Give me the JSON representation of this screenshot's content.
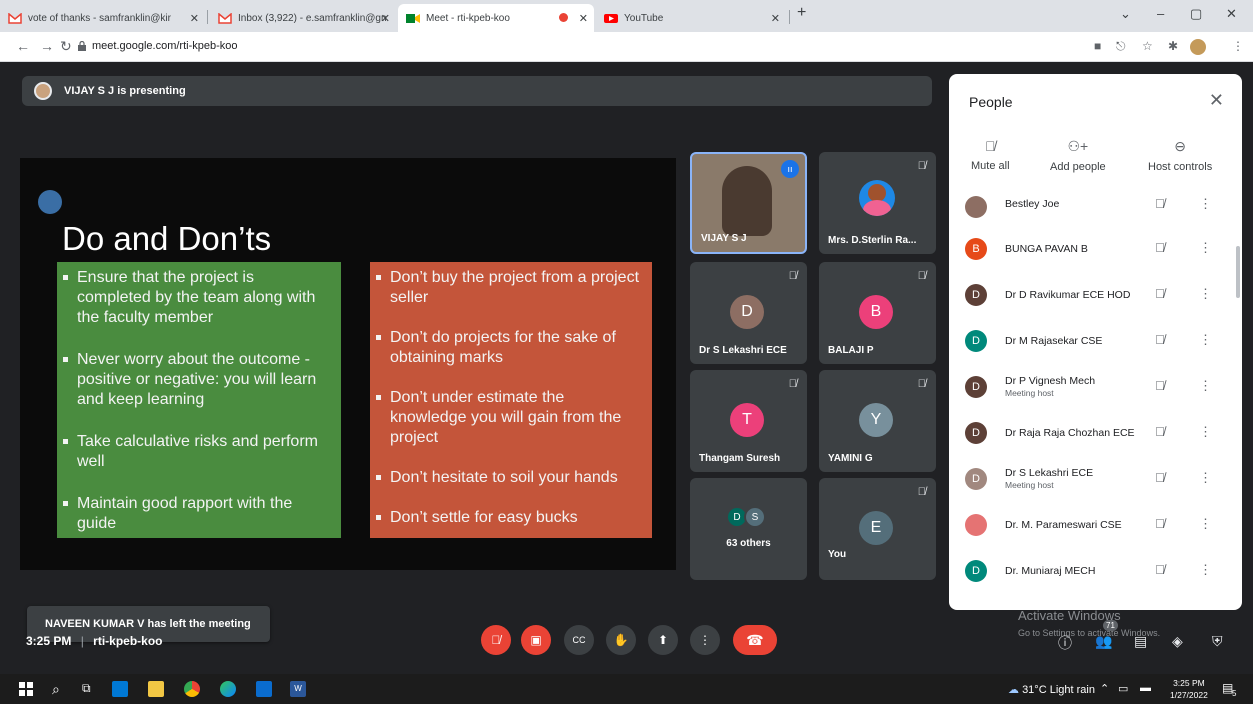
{
  "browser": {
    "tabs": [
      {
        "label": "vote of thanks - samfranklin@kir",
        "icon": "gmail-icon"
      },
      {
        "label": "Inbox (3,922) - e.samfranklin@gn",
        "icon": "gmail-icon"
      },
      {
        "label": "Meet - rti-kpeb-koo",
        "icon": "meet-icon"
      },
      {
        "label": "YouTube",
        "icon": "youtube-icon"
      }
    ],
    "url": "meet.google.com/rti-kpeb-koo"
  },
  "presenting": {
    "text": "VIJAY S J is presenting"
  },
  "slide": {
    "title": "Do and Don’ts",
    "dos": [
      "Ensure that the project is completed by the team along with the faculty member",
      "Never worry about the outcome - positive or negative: you will learn and keep learning",
      "Take calculative risks and perform well",
      "Maintain good rapport with the guide"
    ],
    "donts": [
      "Don’t buy the project from a project seller",
      "Don’t do projects for the sake of obtaining marks",
      "Don’t under estimate the knowledge you will gain from the project",
      "Don’t hesitate to soil your hands",
      "Don’t settle for easy bucks"
    ]
  },
  "toast": "NAVEEN KUMAR V has left the meeting",
  "tiles": {
    "vijay": "VIJAY S J",
    "sterlin": "Mrs. D.Sterlin Ra...",
    "lekashri": {
      "name": "Dr S Lekashri ECE",
      "initial": "D"
    },
    "balaji": {
      "name": "BALAJI P",
      "initial": "B"
    },
    "thangam": {
      "name": "Thangam Suresh",
      "initial": "T"
    },
    "yamini": {
      "name": "YAMINI G",
      "initial": "Y"
    },
    "others": {
      "label": "63 others",
      "initial1": "D",
      "initial2": "S"
    },
    "you": {
      "name": "You",
      "initial": "E"
    }
  },
  "people": {
    "title": "People",
    "controls": {
      "mute_all": "Mute all",
      "add_people": "Add people",
      "host_controls": "Host controls"
    },
    "list": [
      {
        "name": "Bestley Joe",
        "initial": "",
        "color": "#8d6e63",
        "sub": ""
      },
      {
        "name": "BUNGA PAVAN B",
        "initial": "B",
        "color": "#e64a19",
        "sub": ""
      },
      {
        "name": "Dr D Ravikumar ECE HOD",
        "initial": "D",
        "color": "#5d4037",
        "sub": ""
      },
      {
        "name": "Dr M Rajasekar CSE",
        "initial": "D",
        "color": "#00897b",
        "sub": ""
      },
      {
        "name": "Dr P Vignesh Mech",
        "initial": "D",
        "color": "#5d4037",
        "sub": "Meeting host"
      },
      {
        "name": "Dr Raja Raja Chozhan ECE",
        "initial": "D",
        "color": "#5d4037",
        "sub": ""
      },
      {
        "name": "Dr S Lekashri ECE",
        "initial": "D",
        "color": "#a1887f",
        "sub": "Meeting host"
      },
      {
        "name": "Dr. M. Parameswari CSE",
        "initial": "",
        "color": "#e57373",
        "sub": ""
      },
      {
        "name": "Dr. Muniaraj MECH",
        "initial": "D",
        "color": "#00897b",
        "sub": ""
      }
    ]
  },
  "bottom": {
    "time": "3:25 PM",
    "meeting_code": "rti-kpeb-koo",
    "participants_badge": "71",
    "activate_line1": "Activate Windows",
    "activate_line2": "Go to Settings to activate Windows."
  },
  "taskbar": {
    "weather": "31°C  Light rain",
    "clock_time": "3:25 PM",
    "clock_date": "1/27/2022",
    "notif_count": "5"
  }
}
